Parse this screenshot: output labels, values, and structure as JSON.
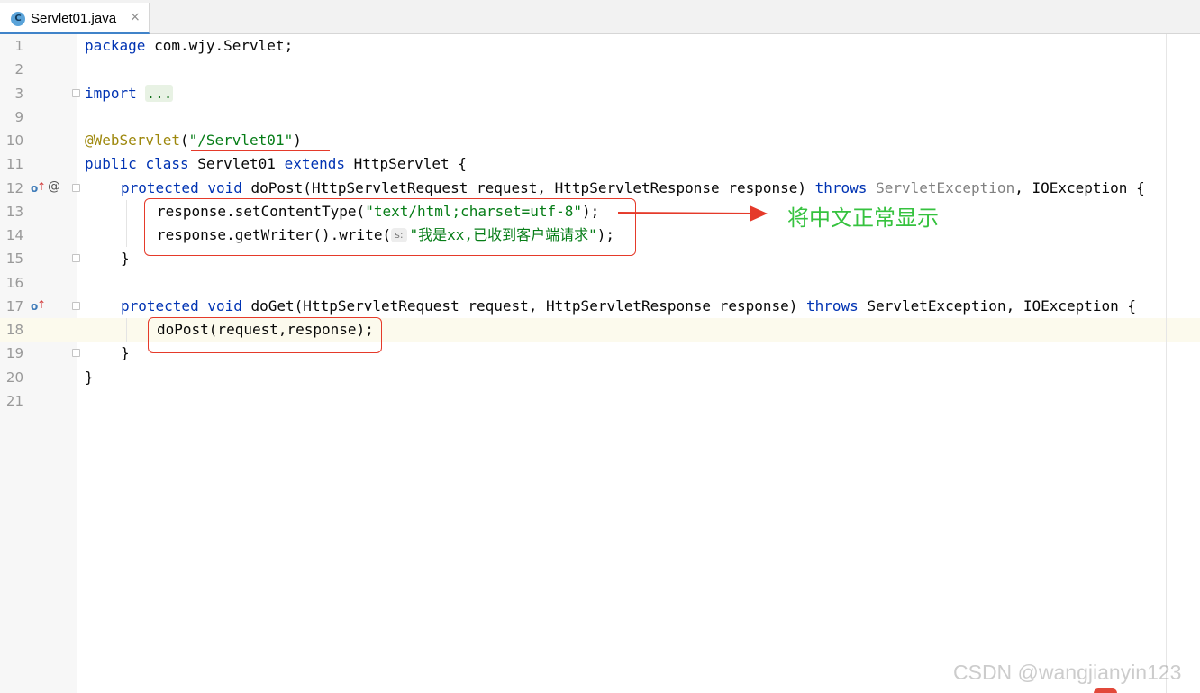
{
  "tab": {
    "icon_letter": "C",
    "label": "Servlet01.java",
    "close_glyph": "×",
    "icon_name": "java-class-icon"
  },
  "gutter": {
    "line_numbers": [
      "1",
      "2",
      "3",
      "9",
      "10",
      "11",
      "12",
      "13",
      "14",
      "15",
      "16",
      "17",
      "18",
      "19",
      "20",
      "21"
    ],
    "overrides_marker_glyph": "↑",
    "impl_marker_glyph": "o",
    "annotation_marker_glyph": "@"
  },
  "code": {
    "l1_kw": "package",
    "l1_rest": " com.wjy.Servlet;",
    "l3_kw": "import",
    "l3_dots": "...",
    "l10_ann": "@WebServlet",
    "l10_open": "(",
    "l10_str": "\"/Servlet01\"",
    "l10_close": ")",
    "l11_kw1": "public",
    "l11_kw2": "class",
    "l11_name": " Servlet01 ",
    "l11_kw3": "extends",
    "l11_rest": " HttpServlet {",
    "l12_kw1": "protected",
    "l12_kw2": "void",
    "l12_sig": " doPost(HttpServletRequest request, HttpServletResponse response) ",
    "l12_throws": "throws",
    "l12_exc": " ServletException",
    "l12_rest": ", IOException {",
    "l13_pre": "response.setContentType(",
    "l13_str": "\"text/html;charset=utf-8\"",
    "l13_post": ");",
    "l14_pre": "response.getWriter().write(",
    "l14_hint": "s:",
    "l14_str": "\"我是xx,已收到客户端请求\"",
    "l14_post": ");",
    "l15": "}",
    "l17_kw1": "protected",
    "l17_kw2": "void",
    "l17_sig": " doGet(HttpServletRequest request, HttpServletResponse response) ",
    "l17_throws": "throws",
    "l17_rest": " ServletException, IOException {",
    "l18": "doPost(request,response);",
    "l19": "}",
    "l20": "}"
  },
  "annotation": {
    "text": "将中文正常显示",
    "color": "#36c23f",
    "box_color": "#e53a2a"
  },
  "watermark": "CSDN @wangjianyin123",
  "colors": {
    "keyword": "#0033b3",
    "string": "#067d17",
    "annotation": "#9e880d",
    "tab_underline": "#4083c9"
  }
}
